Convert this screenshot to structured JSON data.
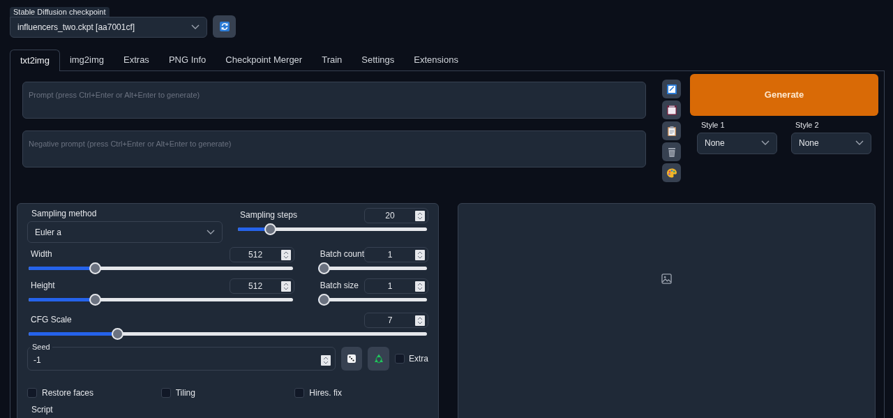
{
  "checkpoint": {
    "label": "Stable Diffusion checkpoint",
    "value": "influencers_two.ckpt [aa7001cf]"
  },
  "tabs": [
    {
      "label": "txt2img",
      "selected": true
    },
    {
      "label": "img2img",
      "selected": false
    },
    {
      "label": "Extras",
      "selected": false
    },
    {
      "label": "PNG Info",
      "selected": false
    },
    {
      "label": "Checkpoint Merger",
      "selected": false
    },
    {
      "label": "Train",
      "selected": false
    },
    {
      "label": "Settings",
      "selected": false
    },
    {
      "label": "Extensions",
      "selected": false
    }
  ],
  "prompt": {
    "placeholder": "Prompt (press Ctrl+Enter or Alt+Enter to generate)"
  },
  "negative_prompt": {
    "placeholder": "Negative prompt (press Ctrl+Enter or Alt+Enter to generate)"
  },
  "generate_button": "Generate",
  "styles": [
    {
      "label": "Style 1",
      "value": "None"
    },
    {
      "label": "Style 2",
      "value": "None"
    }
  ],
  "sampling_method": {
    "label": "Sampling method",
    "value": "Euler a"
  },
  "sampling_steps": {
    "label": "Sampling steps",
    "value": "20",
    "level": 0.15
  },
  "width": {
    "label": "Width",
    "value": "512",
    "level": 0.24
  },
  "height": {
    "label": "Height",
    "value": "512",
    "level": 0.24
  },
  "batch_count": {
    "label": "Batch count",
    "value": "1",
    "level": 0
  },
  "batch_size": {
    "label": "Batch size",
    "value": "1",
    "level": 0
  },
  "cfg_scale": {
    "label": "CFG Scale",
    "value": "7",
    "level": 0.215
  },
  "seed": {
    "label": "Seed",
    "value": "-1"
  },
  "extra": {
    "label": "Extra",
    "checked": false
  },
  "options": [
    {
      "label": "Restore faces",
      "checked": false
    },
    {
      "label": "Tiling",
      "checked": false
    },
    {
      "label": "Hires. fix",
      "checked": false
    }
  ],
  "script": {
    "label": "Script"
  }
}
